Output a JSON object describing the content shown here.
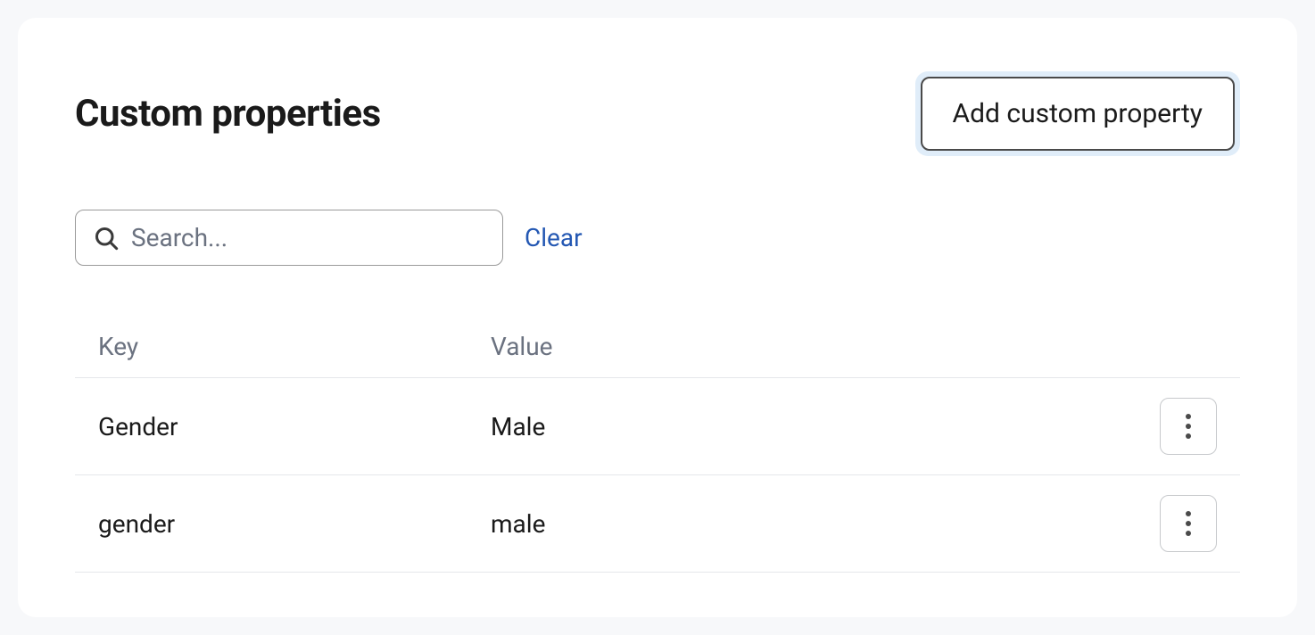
{
  "header": {
    "title": "Custom properties",
    "add_button_label": "Add custom property"
  },
  "search": {
    "placeholder": "Search...",
    "value": "",
    "clear_label": "Clear"
  },
  "table": {
    "columns": {
      "key": "Key",
      "value": "Value"
    },
    "rows": [
      {
        "key": "Gender",
        "value": "Male"
      },
      {
        "key": "gender",
        "value": "male"
      }
    ]
  }
}
